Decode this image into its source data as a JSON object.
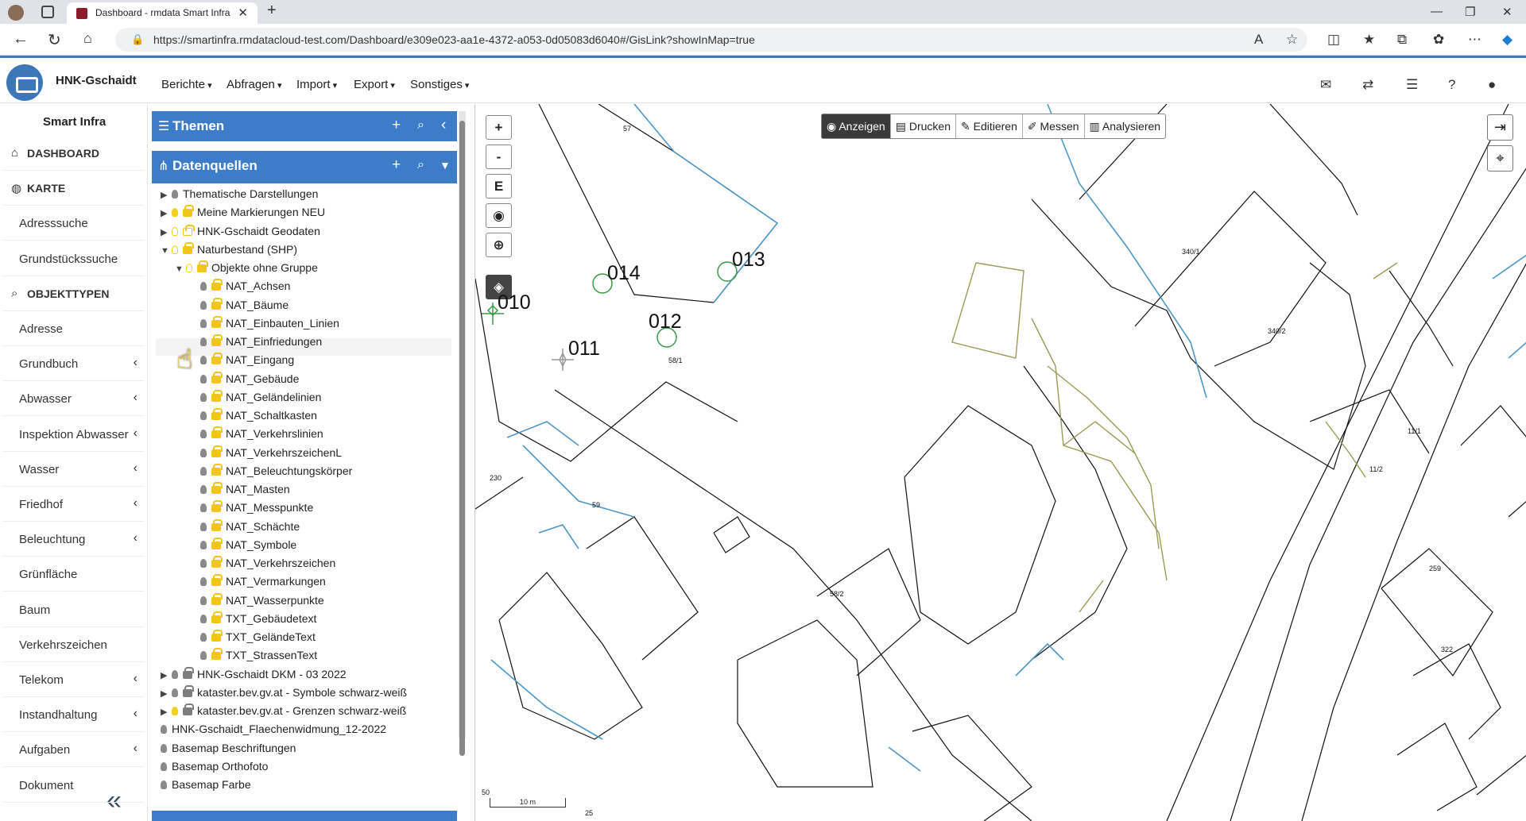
{
  "browser": {
    "tab_title": "Dashboard - rmdata Smart Infra",
    "url": "https://smartinfra.rmdatacloud-test.com/Dashboard/e309e023-aa1e-4372-a053-0d05083d6040#/GisLink?showInMap=true"
  },
  "header": {
    "org_name": "HNK-Gschaidt",
    "menus": [
      "Berichte",
      "Abfragen",
      "Import",
      "Export",
      "Sonstiges"
    ]
  },
  "leftnav": {
    "title": "Smart Infra",
    "items": [
      {
        "label": "DASHBOARD",
        "section": true,
        "icon": "home-icon"
      },
      {
        "label": "KARTE",
        "section": true,
        "icon": "globe-icon"
      },
      {
        "label": "Adresssuche"
      },
      {
        "label": "Grundstückssuche"
      },
      {
        "label": "OBJEKTTYPEN",
        "section": true,
        "icon": "search-icon"
      },
      {
        "label": "Adresse"
      },
      {
        "label": "Grundbuch",
        "chev": true
      },
      {
        "label": "Abwasser",
        "chev": true
      },
      {
        "label": "Inspektion Abwasser",
        "chev": true
      },
      {
        "label": "Wasser",
        "chev": true
      },
      {
        "label": "Friedhof",
        "chev": true
      },
      {
        "label": "Beleuchtung",
        "chev": true
      },
      {
        "label": "Grünfläche"
      },
      {
        "label": "Baum"
      },
      {
        "label": "Verkehrszeichen"
      },
      {
        "label": "Telekom",
        "chev": true
      },
      {
        "label": "Instandhaltung",
        "chev": true
      },
      {
        "label": "Aufgaben",
        "chev": true
      },
      {
        "label": "Dokument"
      }
    ]
  },
  "panel": {
    "themen_label": "Themen",
    "datenquellen_label": "Datenquellen",
    "tree": [
      {
        "label": "Thematische Darstellungen",
        "level": 0,
        "arrow": "▶",
        "bulb": "grey",
        "lock": "none"
      },
      {
        "label": "Meine Markierungen NEU",
        "level": 0,
        "arrow": "▶",
        "bulb": "on",
        "lock": "yellow"
      },
      {
        "label": "HNK-Gschaidt Geodaten",
        "level": 0,
        "arrow": "▶",
        "bulb": "off",
        "lock": "open"
      },
      {
        "label": "Naturbestand (SHP)",
        "level": 0,
        "arrow": "▼",
        "bulb": "off",
        "lock": "yellow"
      },
      {
        "label": "Objekte ohne Gruppe",
        "level": 1,
        "arrow": "▼",
        "bulb": "off",
        "lock": "yellow"
      },
      {
        "label": "NAT_Achsen",
        "level": 2,
        "bulb": "grey",
        "lock": "yellow"
      },
      {
        "label": "NAT_Bäume",
        "level": 2,
        "bulb": "grey",
        "lock": "yellow"
      },
      {
        "label": "NAT_Einbauten_Linien",
        "level": 2,
        "bulb": "grey",
        "lock": "yellow"
      },
      {
        "label": "NAT_Einfriedungen",
        "level": 2,
        "bulb": "grey",
        "lock": "yellow"
      },
      {
        "label": "NAT_Eingang",
        "level": 2,
        "bulb": "grey",
        "lock": "yellow"
      },
      {
        "label": "NAT_Gebäude",
        "level": 2,
        "bulb": "grey",
        "lock": "yellow"
      },
      {
        "label": "NAT_Geländelinien",
        "level": 2,
        "bulb": "grey",
        "lock": "yellow"
      },
      {
        "label": "NAT_Schaltkasten",
        "level": 2,
        "bulb": "grey",
        "lock": "yellow"
      },
      {
        "label": "NAT_Verkehrslinien",
        "level": 2,
        "bulb": "grey",
        "lock": "yellow"
      },
      {
        "label": "NAT_VerkehrszeichenL",
        "level": 2,
        "bulb": "grey",
        "lock": "yellow"
      },
      {
        "label": "NAT_Beleuchtungskörper",
        "level": 2,
        "bulb": "grey",
        "lock": "yellow"
      },
      {
        "label": "NAT_Masten",
        "level": 2,
        "bulb": "grey",
        "lock": "yellow"
      },
      {
        "label": "NAT_Messpunkte",
        "level": 2,
        "bulb": "grey",
        "lock": "yellow"
      },
      {
        "label": "NAT_Schächte",
        "level": 2,
        "bulb": "grey",
        "lock": "yellow"
      },
      {
        "label": "NAT_Symbole",
        "level": 2,
        "bulb": "grey",
        "lock": "yellow"
      },
      {
        "label": "NAT_Verkehrszeichen",
        "level": 2,
        "bulb": "grey",
        "lock": "yellow"
      },
      {
        "label": "NAT_Vermarkungen",
        "level": 2,
        "bulb": "grey",
        "lock": "yellow"
      },
      {
        "label": "NAT_Wasserpunkte",
        "level": 2,
        "bulb": "grey",
        "lock": "yellow"
      },
      {
        "label": "TXT_Gebäudetext",
        "level": 2,
        "bulb": "grey",
        "lock": "yellow"
      },
      {
        "label": "TXT_GeländeText",
        "level": 2,
        "bulb": "grey",
        "lock": "yellow"
      },
      {
        "label": "TXT_StrassenText",
        "level": 2,
        "bulb": "grey",
        "lock": "yellow"
      },
      {
        "label": "HNK-Gschaidt DKM - 03 2022",
        "level": 0,
        "arrow": "▶",
        "bulb": "grey",
        "lock": "grey"
      },
      {
        "label": "kataster.bev.gv.at - Symbole schwarz-weiß",
        "level": 0,
        "arrow": "▶",
        "bulb": "grey",
        "lock": "grey"
      },
      {
        "label": "kataster.bev.gv.at - Grenzen schwarz-weiß",
        "level": 0,
        "arrow": "▶",
        "bulb": "on",
        "lock": "grey"
      },
      {
        "label": "HNK-Gschaidt_Flaechenwidmung_12-2022",
        "level": -1,
        "bulb": "grey",
        "lock": "none"
      },
      {
        "label": "Basemap Beschriftungen",
        "level": -1,
        "bulb": "grey",
        "lock": "none"
      },
      {
        "label": "Basemap Orthofoto",
        "level": -1,
        "bulb": "grey",
        "lock": "none"
      },
      {
        "label": "Basemap Farbe",
        "level": -1,
        "bulb": "grey",
        "lock": "none"
      }
    ]
  },
  "map": {
    "toolbar": [
      "Anzeigen",
      "Drucken",
      "Editieren",
      "Messen",
      "Analysieren"
    ],
    "active_tool": "Anzeigen",
    "zoom_in": "+",
    "zoom_out": "-",
    "extent_btn": "E",
    "points": [
      "010",
      "011",
      "012",
      "013",
      "014"
    ],
    "parcels": [
      "57",
      "58/1",
      "59",
      "58/2",
      "340/1",
      "340/2",
      "230",
      "259",
      "322",
      "11/1",
      "11/2",
      "25",
      "50"
    ],
    "scale": "10 m"
  }
}
